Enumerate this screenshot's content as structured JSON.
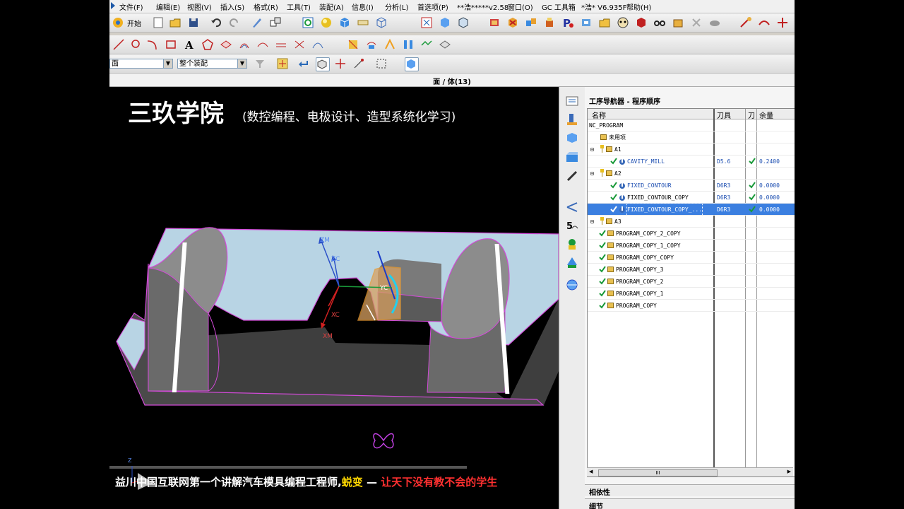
{
  "menu": {
    "items": [
      "文件(F)",
      "编辑(E)",
      "视图(V)",
      "插入(S)",
      "格式(R)",
      "工具(T)",
      "装配(A)",
      "信息(I)",
      "分析(L)",
      "首选项(P)",
      "**浩*****v2.58",
      "窗口(O)",
      "GC 工具箱",
      "*浩* V6.935F",
      "帮助(H)"
    ]
  },
  "toolbar": {
    "start_label": "开始"
  },
  "selection_bar": {
    "filter_value": "面",
    "scope_value": "整个装配"
  },
  "status_title": "面 / 体(13)",
  "viewport": {
    "brand_title": "三玖学院",
    "brand_subtitle": "(数控编程、电极设计、造型系统化学习)",
    "axes": {
      "zm": "ZM",
      "zc": "ZC",
      "xc": "XC",
      "xm": "XM",
      "yc": "YC"
    },
    "triad": {
      "z": "Z"
    },
    "banner": {
      "prefix": "益川",
      "middle": "中国互联网第一个讲解汽车模具编程工程师,",
      "name": "蜕变",
      "dash": "—",
      "slogan": "让天下没有教不会的学生"
    },
    "colors": {
      "part_top": "#b8d4e4",
      "part_side": "#4a4a4a",
      "edge": "#d24ad8",
      "tool": "#e89a30"
    }
  },
  "navigator": {
    "title": "工序导航器 - 程序顺序",
    "columns": {
      "name": "名称",
      "tool": "刀具",
      "tool_short": "刀",
      "stock": "余量"
    },
    "rows": [
      {
        "name": "NC_PROGRAM",
        "tool": "",
        "stock": "",
        "level": 0,
        "kind": "root"
      },
      {
        "name": "未用项",
        "tool": "",
        "stock": "",
        "level": 1,
        "kind": "folder"
      },
      {
        "name": "A1",
        "tool": "",
        "stock": "",
        "level": 1,
        "kind": "group"
      },
      {
        "name": "CAVITY_MILL",
        "tool": "D5.6",
        "stock": "0.2400",
        "level": 2,
        "kind": "op"
      },
      {
        "name": "A2",
        "tool": "",
        "stock": "",
        "level": 1,
        "kind": "group"
      },
      {
        "name": "FIXED_CONTOUR",
        "tool": "D6R3",
        "stock": "0.0000",
        "level": 2,
        "kind": "op"
      },
      {
        "name": "FIXED_CONTOUR_COPY",
        "tool": "D6R3",
        "stock": "0.0000",
        "level": 2,
        "kind": "op-plain"
      },
      {
        "name": "FIXED_CONTOUR_COPY_...",
        "tool": "D6R3",
        "stock": "0.0000",
        "level": 2,
        "kind": "op",
        "selected": true
      },
      {
        "name": "A3",
        "tool": "",
        "stock": "",
        "level": 1,
        "kind": "group"
      },
      {
        "name": "PROGRAM_COPY_2_COPY",
        "tool": "",
        "stock": "",
        "level": 1,
        "kind": "program"
      },
      {
        "name": "PROGRAM_COPY_1_COPY",
        "tool": "",
        "stock": "",
        "level": 1,
        "kind": "program"
      },
      {
        "name": "PROGRAM_COPY_COPY",
        "tool": "",
        "stock": "",
        "level": 1,
        "kind": "program"
      },
      {
        "name": "PROGRAM_COPY_3",
        "tool": "",
        "stock": "",
        "level": 1,
        "kind": "program"
      },
      {
        "name": "PROGRAM_COPY_2",
        "tool": "",
        "stock": "",
        "level": 1,
        "kind": "program"
      },
      {
        "name": "PROGRAM_COPY_1",
        "tool": "",
        "stock": "",
        "level": 1,
        "kind": "program"
      },
      {
        "name": "PROGRAM_COPY",
        "tool": "",
        "stock": "",
        "level": 1,
        "kind": "program"
      }
    ],
    "scroll_thumb": "III",
    "dependencies_label": "相依性",
    "details_label": "细节"
  }
}
